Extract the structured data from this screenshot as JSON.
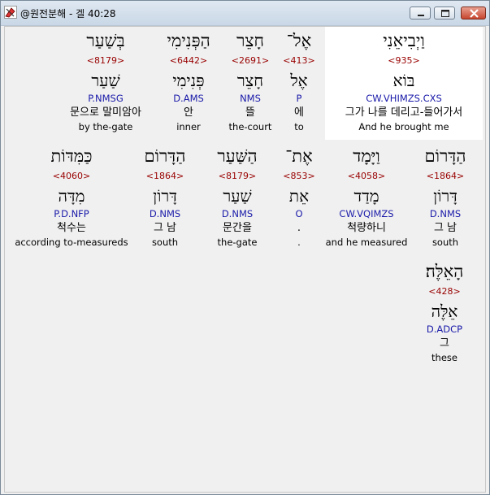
{
  "window": {
    "title": "@원전분해 - 겔 40:28",
    "app_icon": "app-icon",
    "controls": {
      "minimize": "minimize-icon",
      "maximize": "maximize-icon",
      "close": "close-icon"
    }
  },
  "colors": {
    "strong_number": "#990000",
    "parsing": "#1a1aaa",
    "highlight_bg": "#ffffff"
  },
  "rows": [
    [
      {
        "hebrew": "וַיְבִיאֵנִי",
        "strong": "<935>",
        "lemma": "בּוֹא",
        "parsing": "CW.VHIMZS.CXS",
        "korean": "그가 나를 데리고-들어가서",
        "english": "And he brought me",
        "highlighted": true
      },
      {
        "hebrew": "אֶל־",
        "strong": "<413>",
        "lemma": "אֶל",
        "parsing": "P",
        "korean": "에",
        "english": "to"
      },
      {
        "hebrew": "חָצֵר",
        "strong": "<2691>",
        "lemma": "חָצֵר",
        "parsing": "NMS",
        "korean": "뜰",
        "english": "the-court"
      },
      {
        "hebrew": "הַפְּנִימִי",
        "strong": "<6442>",
        "lemma": "פְּנִימִי",
        "parsing": "D.AMS",
        "korean": "안",
        "english": "inner"
      },
      {
        "hebrew": "בְּשַׁעַר",
        "strong": "<8179>",
        "lemma": "שַׁעַר",
        "parsing": "P.NMSG",
        "korean": "문으로 말미암아",
        "english": "by the-gate"
      }
    ],
    [
      {
        "hebrew": "הַדָּרוֹם",
        "strong": "<1864>",
        "lemma": "דָּרוֹן",
        "parsing": "D.NMS",
        "korean": "그 남",
        "english": "south"
      },
      {
        "hebrew": "וַיָּמָד",
        "strong": "<4058>",
        "lemma": "מָדַד",
        "parsing": "CW.VQIMZS",
        "korean": "척량하니",
        "english": "and he measured"
      },
      {
        "hebrew": "אֶת־",
        "strong": "<853>",
        "lemma": "אֵת",
        "parsing": "O",
        "korean": ".",
        "english": "."
      },
      {
        "hebrew": "הַשַּׁעַר",
        "strong": "<8179>",
        "lemma": "שַׁעַר",
        "parsing": "D.NMS",
        "korean": "문간을",
        "english": "the-gate"
      },
      {
        "hebrew": "הַדָּרוֹם",
        "strong": "<1864>",
        "lemma": "דָּרוֹן",
        "parsing": "D.NMS",
        "korean": "그 남",
        "english": "south"
      },
      {
        "hebrew": "כַּמִּדּוֹת",
        "strong": "<4060>",
        "lemma": "מִדָּה",
        "parsing": "P.D.NFP",
        "korean": "척수는",
        "english": "according to-measureds"
      }
    ],
    [
      {
        "hebrew": "הָאֵלֶּה׃",
        "strong": "<428>",
        "lemma": "אֵלֶּה",
        "parsing": "D.ADCP",
        "korean": "그",
        "english": "these"
      }
    ]
  ]
}
